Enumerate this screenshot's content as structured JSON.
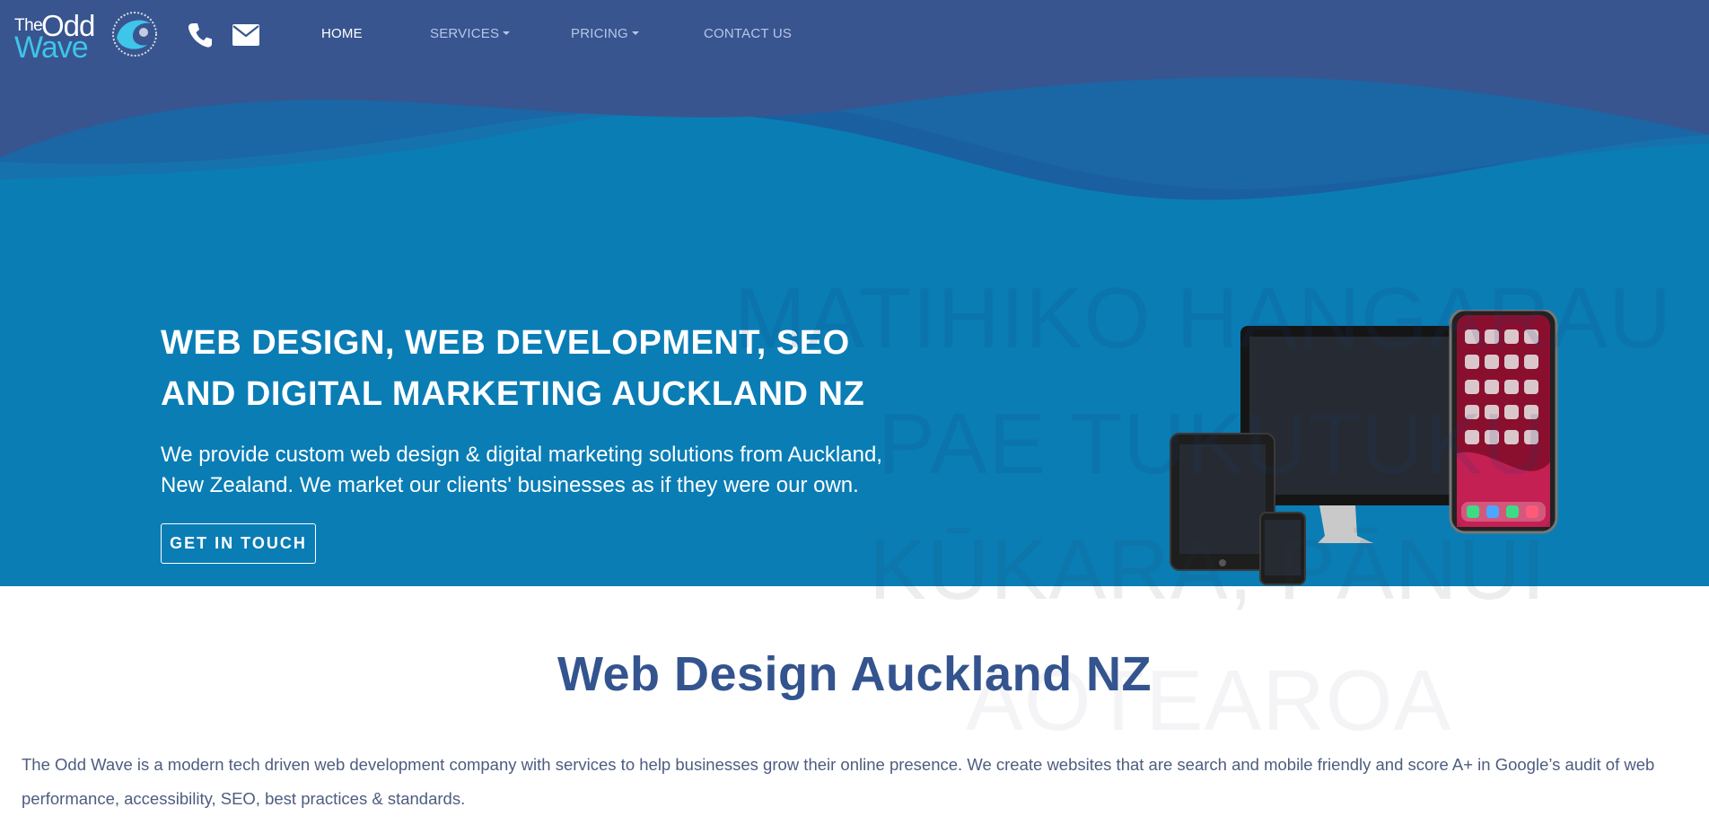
{
  "colors": {
    "nav_bg": "#38558f",
    "hero_bg": "#0a7db5",
    "accent_cyan": "#3fc4ea",
    "heading": "#34548f",
    "body_text": "#4d5d80"
  },
  "logo": {
    "the": "The",
    "odd": "Odd",
    "wave": "Wave"
  },
  "nav": {
    "phone_icon": "phone-icon",
    "email_icon": "envelope-icon",
    "home": "HOME",
    "services": "SERVICES",
    "pricing": "PRICING",
    "contact": "CONTACT US"
  },
  "hero": {
    "title_line1": "WEB DESIGN, WEB DEVELOPMENT, SEO",
    "title_line2": "AND DIGITAL MARKETING AUCKLAND NZ",
    "subtitle_line1": "We provide custom web design & digital marketing solutions from Auckland,",
    "subtitle_line2": "New Zealand. We market our clients' businesses as if they were our own.",
    "cta_label": "GET IN TOUCH",
    "watermark": [
      "MATIHIKO HANGARAU",
      "PAE TUKUTUKU",
      "KŪKARA, PĀNUI",
      "AOTEAROA"
    ]
  },
  "section": {
    "title": "Web Design Auckland NZ",
    "text": "The Odd Wave is a modern tech driven web development company with services to help businesses grow their online presence. We create websites that are search and mobile friendly and score A+ in Google’s audit of web performance, accessibility, SEO, best practices & standards."
  }
}
